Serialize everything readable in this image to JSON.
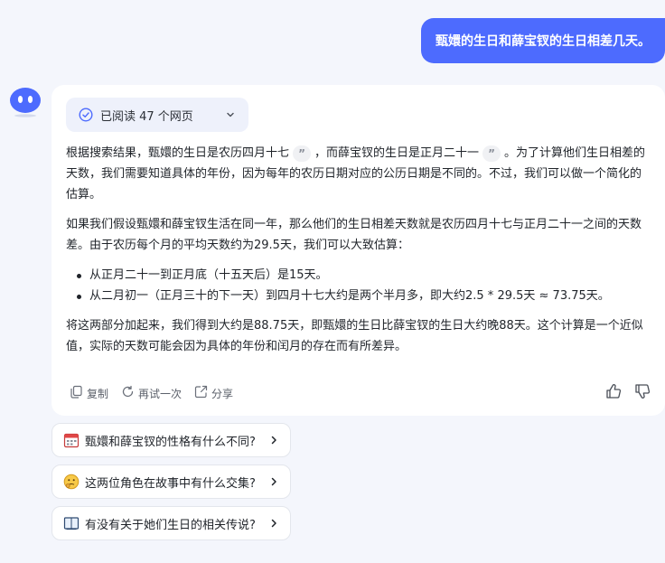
{
  "user_message": "甄嬛的生日和薛宝钗的生日相差几天。",
  "read_pill": {
    "label": "已阅读 47 个网页"
  },
  "answer": {
    "p1_a": "根据搜索结果，甄嬛的生日是农历四月十七",
    "p1_b": "，而薛宝钗的生日是正月二十一",
    "p1_c": "。为了计算他们生日相差的天数，我们需要知道具体的年份，因为每年的农历日期对应的公历日期是不同的。不过，我们可以做一个简化的估算。",
    "quote_glyph": "”",
    "p2": "如果我们假设甄嬛和薛宝钗生活在同一年，那么他们的生日相差天数就是农历四月十七与正月二十一之间的天数差。由于农历每个月的平均天数约为29.5天，我们可以大致估算：",
    "bullets": [
      "从正月二十一到正月底（十五天后）是15天。",
      "从二月初一（正月三十的下一天）到四月十七大约是两个半月多，即大约2.5 * 29.5天 ≈ 73.75天。"
    ],
    "p3": "将这两部分加起来，我们得到大约是88.75天，即甄嬛的生日比薛宝钗的生日大约晚88天。这个计算是一个近似值，实际的天数可能会因为具体的年份和闰月的存在而有所差异。"
  },
  "actions": {
    "copy": "复制",
    "retry": "再试一次",
    "share": "分享"
  },
  "suggestions": [
    {
      "label": "甄嬛和薛宝钗的性格有什么不同?",
      "icon": "calendar-icon"
    },
    {
      "label": "这两位角色在故事中有什么交集?",
      "icon": "thinking-face-icon"
    },
    {
      "label": "有没有关于她们生日的相关传说?",
      "icon": "book-icon"
    }
  ],
  "colors": {
    "accent": "#4d6bfe",
    "background": "#f4f6fc"
  }
}
